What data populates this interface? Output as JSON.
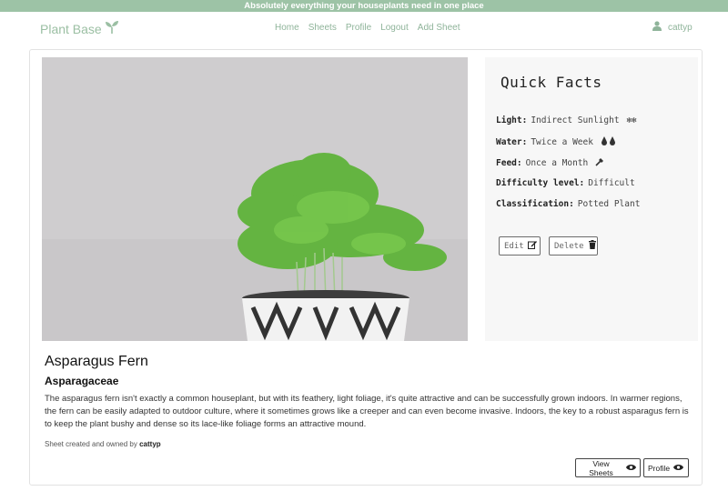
{
  "banner": {
    "text": "Absolutely everything your houseplants need in one place"
  },
  "navbar": {
    "brand": "Plant Base",
    "links": [
      "Home",
      "Sheets",
      "Profile",
      "Logout",
      "Add Sheet"
    ],
    "user": "cattyp"
  },
  "quick_facts": {
    "title": "Quick Facts",
    "facts": [
      {
        "label": "Light:",
        "value": "Indirect Sunlight",
        "icon": "sun-icons"
      },
      {
        "label": "Water:",
        "value": "Twice a Week",
        "icon": "water-drops-icon"
      },
      {
        "label": "Feed:",
        "value": "Once a Month",
        "icon": "eyedropper-icon"
      },
      {
        "label": "Difficulty level:",
        "value": "Difficult"
      },
      {
        "label": "Classification:",
        "value": "Potted Plant"
      }
    ],
    "edit_label": "Edit",
    "delete_label": "Delete"
  },
  "plant": {
    "name": "Asparagus Fern",
    "family": "Asparagaceae",
    "description": "The asparagus fern isn't exactly a common houseplant, but with its feathery, light foliage, it's quite attractive and can be successfully grown indoors. In warmer regions, the fern can be easily adapted to outdoor culture, where it sometimes grows like a creeper and can even become invasive. Indoors, the key to a robust asparagus fern is to keep the plant bushy and dense so its lace-like foliage forms an attractive mound.",
    "owner_prefix": "Sheet created and owned by",
    "owner": "cattyp"
  },
  "actions": {
    "view_sheets": "View Sheets",
    "profile": "Profile"
  },
  "colors": {
    "accent": "#9dc3a6",
    "brand_text": "#9bbfa3"
  }
}
